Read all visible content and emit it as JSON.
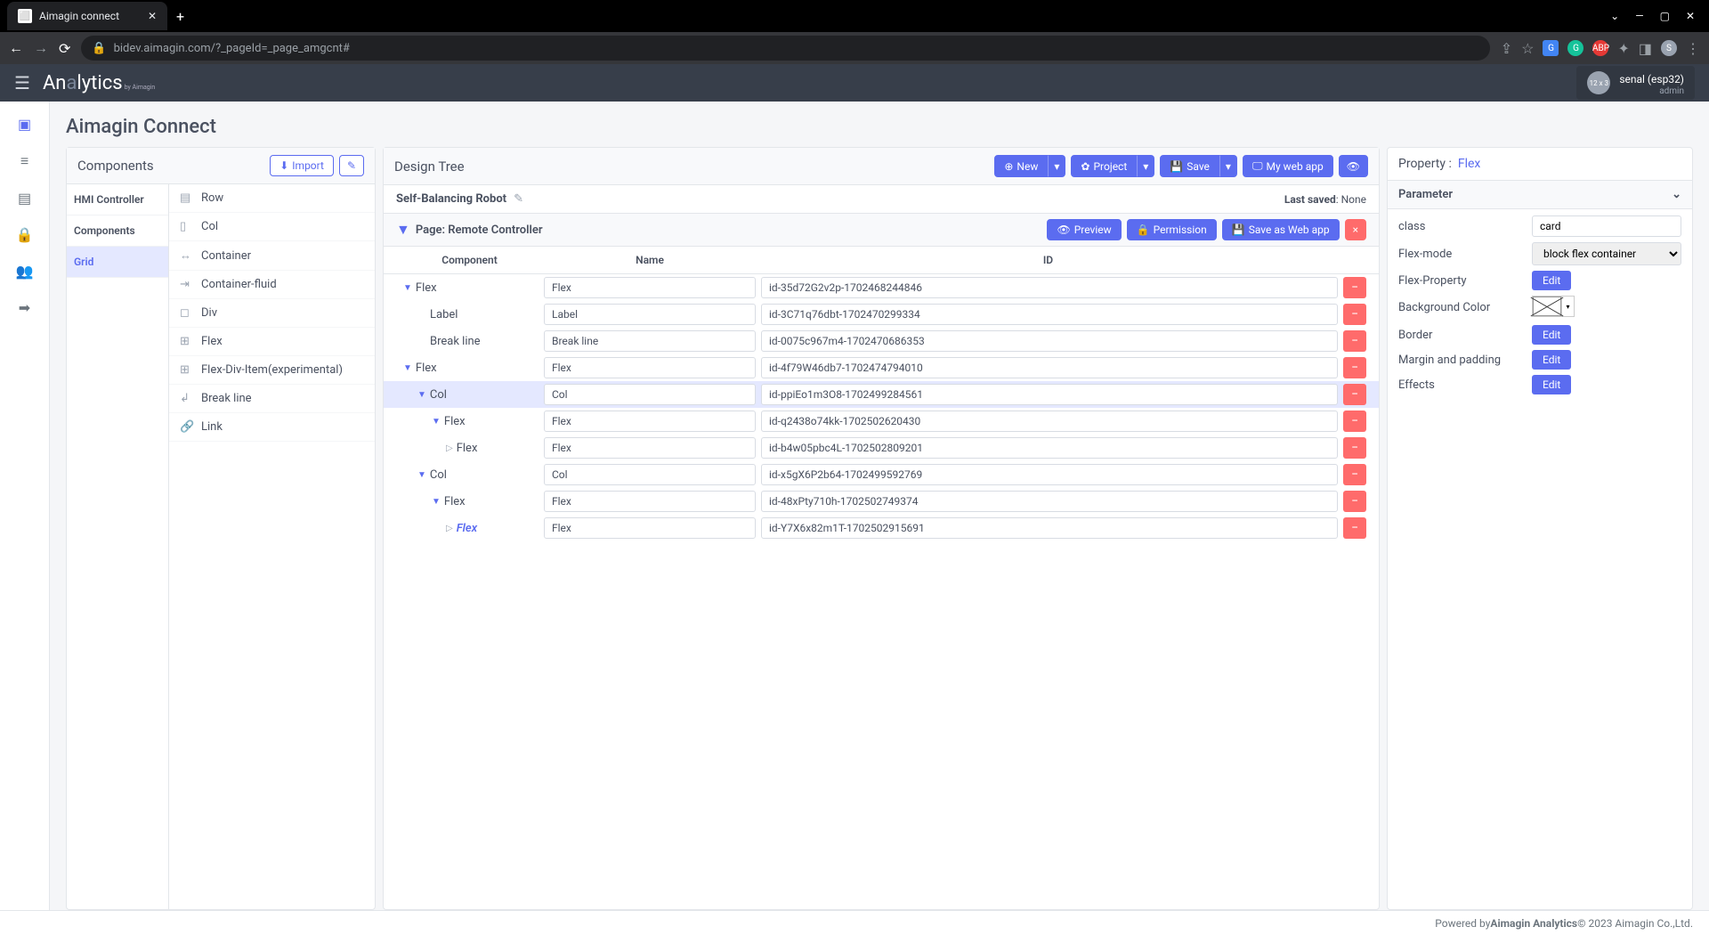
{
  "browser": {
    "tab_title": "Aimagin connect",
    "url": "bidev.aimagin.com/?_pageId=_page_amgcnt#"
  },
  "header": {
    "logo_main": "An",
    "logo_mid": "a",
    "logo_rest": "lytics",
    "logo_sub": "by Aimagin",
    "user_name": "senal (esp32)",
    "user_role": "admin"
  },
  "page": {
    "title": "Aimagin Connect"
  },
  "components": {
    "panel_title": "Components",
    "import_label": "Import",
    "categories": [
      {
        "label": "HMI Controller",
        "active": false
      },
      {
        "label": "Components",
        "active": false
      },
      {
        "label": "Grid",
        "active": true
      }
    ],
    "items": [
      {
        "icon": "▤",
        "label": "Row"
      },
      {
        "icon": "▯",
        "label": "Col"
      },
      {
        "icon": "↔",
        "label": "Container"
      },
      {
        "icon": "⇥",
        "label": "Container-fluid"
      },
      {
        "icon": "◻",
        "label": "Div"
      },
      {
        "icon": "⊞",
        "label": "Flex"
      },
      {
        "icon": "⊞",
        "label": "Flex-Div-Item(experimental)"
      },
      {
        "icon": "↲",
        "label": "Break line"
      },
      {
        "icon": "🔗",
        "label": "Link"
      }
    ]
  },
  "design": {
    "panel_title": "Design Tree",
    "new_label": "New",
    "project_label": "Project",
    "save_label": "Save",
    "webapp_label": "My web app",
    "robot_name": "Self-Balancing Robot",
    "last_saved_label": "Last saved",
    "last_saved_value": "None",
    "page_name": "Page: Remote Controller",
    "preview_label": "Preview",
    "permission_label": "Permission",
    "saveas_label": "Save as Web app",
    "close_label": "×",
    "cols": {
      "component": "Component",
      "name": "Name",
      "id": "ID"
    },
    "tree": [
      {
        "indent": 0,
        "caret": "open",
        "label": "Flex",
        "name": "Flex",
        "id": "id-35d72G2v2p-1702468244846",
        "selected": false
      },
      {
        "indent": 1,
        "caret": "none",
        "label": "Label",
        "name": "Label",
        "id": "id-3C71q76dbt-1702470299334",
        "selected": false
      },
      {
        "indent": 1,
        "caret": "none",
        "label": "Break line",
        "name": "Break line",
        "id": "id-0075c967m4-1702470686353",
        "selected": false
      },
      {
        "indent": 0,
        "caret": "open",
        "label": "Flex",
        "name": "Flex",
        "id": "id-4f79W46db7-1702474794010",
        "selected": false
      },
      {
        "indent": 1,
        "caret": "open",
        "label": "Col",
        "name": "Col",
        "id": "id-ppiEo1m3O8-1702499284561",
        "selected": true
      },
      {
        "indent": 2,
        "caret": "open",
        "label": "Flex",
        "name": "Flex",
        "id": "id-q2438o74kk-1702502620430",
        "selected": false
      },
      {
        "indent": 3,
        "caret": "closed",
        "label": "Flex",
        "name": "Flex",
        "id": "id-b4w05pbc4L-1702502809201",
        "selected": false
      },
      {
        "indent": 1,
        "caret": "open",
        "label": "Col",
        "name": "Col",
        "id": "id-x5gX6P2b64-1702499592769",
        "selected": false
      },
      {
        "indent": 2,
        "caret": "open",
        "label": "Flex",
        "name": "Flex",
        "id": "id-48xPty710h-1702502749374",
        "selected": false
      },
      {
        "indent": 3,
        "caret": "closed",
        "label": "Flex",
        "name": "Flex",
        "id": "id-Y7X6x82m1T-1702502915691",
        "selected": false,
        "active": true
      }
    ]
  },
  "property": {
    "label": "Property :",
    "target": "Flex",
    "param_header": "Parameter",
    "rows": {
      "class_label": "class",
      "class_value": "card",
      "flexmode_label": "Flex-mode",
      "flexmode_value": "block flex container",
      "flexprop_label": "Flex-Property",
      "bgcolor_label": "Background Color",
      "border_label": "Border",
      "margin_label": "Margin and padding",
      "effects_label": "Effects",
      "edit_label": "Edit"
    }
  },
  "footer": {
    "prefix": "Powered by ",
    "brand": "Aimagin Analytics",
    "suffix": " © 2023 Aimagin Co.,Ltd."
  }
}
